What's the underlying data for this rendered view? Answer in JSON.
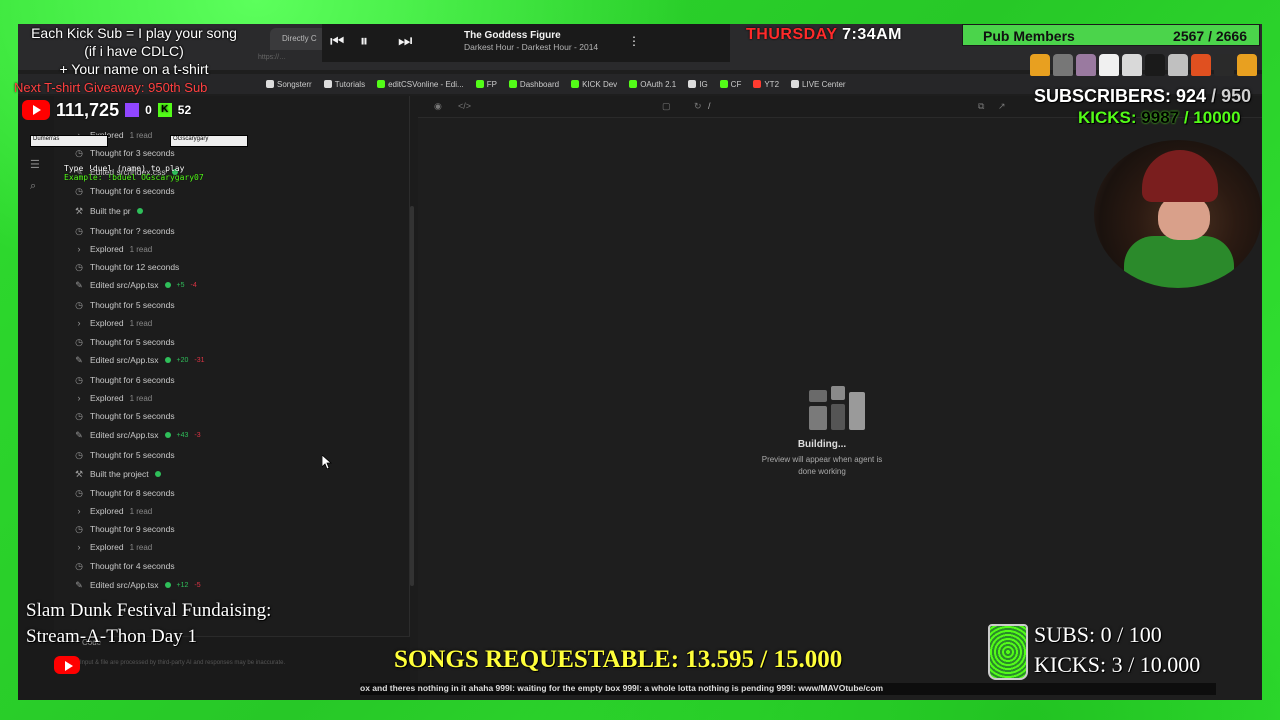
{
  "browser": {
    "tab_title": "Directly C",
    "bookmarks": [
      "Songsterr",
      "Tutorials",
      "editCSVonline - Edi...",
      "FP",
      "Dashboard",
      "KICK Dev",
      "OAuth 2.1",
      "IG",
      "CF",
      "YT2",
      "LIVE Center"
    ]
  },
  "chat": {
    "steps": [
      {
        "icon": "chevron-right-icon",
        "label": "Explored",
        "meta": "1 read"
      },
      {
        "icon": "clock-icon",
        "label": "Thought for 3 seconds",
        "meta": ""
      },
      {
        "icon": "pencil-icon",
        "label": "Edited src/index.css",
        "meta": ""
      },
      {
        "icon": "clock-icon",
        "label": "Thought for 6 seconds",
        "meta": ""
      },
      {
        "icon": "hammer-icon",
        "label": "Built the pr",
        "meta": ""
      },
      {
        "icon": "clock-icon",
        "label": "Thought for ? seconds",
        "meta": ""
      },
      {
        "icon": "chevron-right-icon",
        "label": "Explored",
        "meta": "1 read"
      },
      {
        "icon": "clock-icon",
        "label": "Thought for 12 seconds",
        "meta": ""
      },
      {
        "icon": "pencil-icon",
        "label": "Edited src/App.tsx",
        "meta": "",
        "add": "+5",
        "del": "-4"
      },
      {
        "icon": "clock-icon",
        "label": "Thought for 5 seconds",
        "meta": ""
      },
      {
        "icon": "chevron-right-icon",
        "label": "Explored",
        "meta": "1 read"
      },
      {
        "icon": "clock-icon",
        "label": "Thought for 5 seconds",
        "meta": ""
      },
      {
        "icon": "pencil-icon",
        "label": "Edited src/App.tsx",
        "meta": "",
        "add": "+20",
        "del": "-31"
      },
      {
        "icon": "clock-icon",
        "label": "Thought for 6 seconds",
        "meta": ""
      },
      {
        "icon": "chevron-right-icon",
        "label": "Explored",
        "meta": "1 read"
      },
      {
        "icon": "clock-icon",
        "label": "Thought for 5 seconds",
        "meta": ""
      },
      {
        "icon": "pencil-icon",
        "label": "Edited src/App.tsx",
        "meta": "",
        "add": "+43",
        "del": "-3"
      },
      {
        "icon": "clock-icon",
        "label": "Thought for 5 seconds",
        "meta": ""
      },
      {
        "icon": "hammer-icon",
        "label": "Built the project",
        "meta": ""
      },
      {
        "icon": "clock-icon",
        "label": "Thought for 8 seconds",
        "meta": ""
      },
      {
        "icon": "chevron-right-icon",
        "label": "Explored",
        "meta": "1 read"
      },
      {
        "icon": "clock-icon",
        "label": "Thought for 9 seconds",
        "meta": ""
      },
      {
        "icon": "chevron-right-icon",
        "label": "Explored",
        "meta": "1 read"
      },
      {
        "icon": "clock-icon",
        "label": "Thought for 4 seconds",
        "meta": ""
      },
      {
        "icon": "pencil-icon",
        "label": "Edited src/App.tsx",
        "meta": "",
        "add": "+12",
        "del": "-5"
      }
    ],
    "code_label": "Code",
    "disclaimer": "Input & file are processed by third-party AI and responses may be inaccurate."
  },
  "preview": {
    "path": "/",
    "building_title": "Building...",
    "building_sub_1": "Preview will appear when agent is",
    "building_sub_2": "done working"
  },
  "overlay": {
    "sub_promo_1": "Each Kick Sub = I play your song",
    "sub_promo_2": "(if i have CDLC)",
    "sub_promo_3": "+ Your name on a t-shirt",
    "giveaway": "Next T-shirt Giveaway: 950th Sub",
    "youtube_count": "111,725",
    "twitch_count": "0",
    "kick_count": "52",
    "duel_name_1": "Dumerras",
    "duel_name_2": "OGscarygary",
    "duel_help_1": "Type !duel (name) to play",
    "duel_help_2": "Example: !bduel OGscarygary07",
    "player_title": "The Goddess Figure",
    "player_sub": "Darkest Hour - Darkest Hour - 2014",
    "clock_day": "THURSDAY",
    "clock_time": "7:34AM",
    "pub_label": "Pub Members",
    "pub_count": "2567 / 2666",
    "subs_label": "SUBSCRIBERS:",
    "subs_current": "924",
    "subs_goal": "/ 950",
    "kicks_label": "KICKS:",
    "kicks_current": "9987",
    "kicks_goal": "/ 10000",
    "fundraise_1": "Slam Dunk Festival Fundaising:",
    "fundraise_2": "Stream-A-Thon Day 1",
    "songs": "SONGS REQUESTABLE: 13.595 / 15.000",
    "goal_subs": "SUBS:  0 / 100",
    "goal_kicks": "KICKS: 3 / 10.000",
    "ticker": "ox and theres nothing in it ahaha   999l: waiting for the empty box   999l: a whole lotta nothing is pending   999l:   www/MAVOtube/com"
  },
  "colors": {
    "greenscreen": "#2ee62e",
    "kick_green": "#53fc18",
    "youtube_red": "#ff0000",
    "songs_yellow": "#ffff3a",
    "ok_green": "#2fbf5a"
  }
}
